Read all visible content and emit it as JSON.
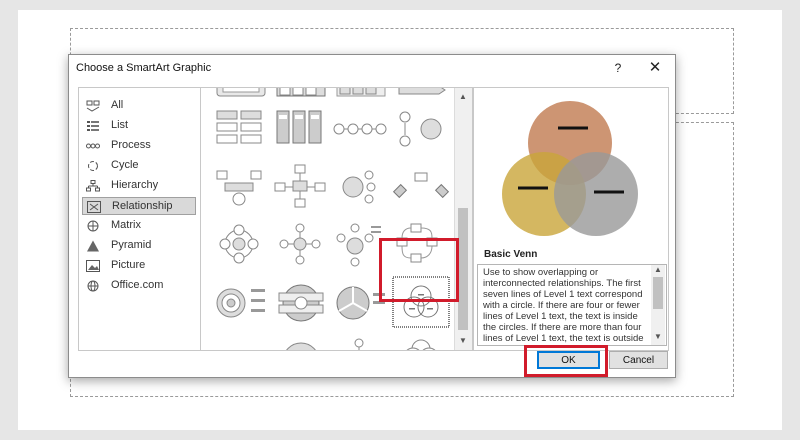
{
  "dialog": {
    "title": "Choose a SmartArt Graphic",
    "help_label": "?",
    "close_label": "✕"
  },
  "categories": [
    {
      "label": "All",
      "icon": "all-icon"
    },
    {
      "label": "List",
      "icon": "list-icon"
    },
    {
      "label": "Process",
      "icon": "process-icon"
    },
    {
      "label": "Cycle",
      "icon": "cycle-icon"
    },
    {
      "label": "Hierarchy",
      "icon": "hierarchy-icon"
    },
    {
      "label": "Relationship",
      "icon": "relationship-icon",
      "selected": true
    },
    {
      "label": "Matrix",
      "icon": "matrix-icon"
    },
    {
      "label": "Pyramid",
      "icon": "pyramid-icon"
    },
    {
      "label": "Picture",
      "icon": "picture-icon"
    },
    {
      "label": "Office.com",
      "icon": "office-icon"
    }
  ],
  "preview": {
    "name": "Basic Venn",
    "description": "Use to show overlapping or interconnected relationships. The first seven lines of Level 1 text correspond with a circle. If there are four or fewer lines of Level 1 text, the text is inside the circles. If there are more than four lines of Level 1 text, the text is outside",
    "marker": "—",
    "colors": {
      "top": "#c07a50",
      "left": "#c9a53a",
      "right": "#999999"
    }
  },
  "buttons": {
    "ok": "OK",
    "cancel": "Cancel"
  },
  "colors": {
    "highlight": "#d11b2b",
    "accent": "#0078d7"
  }
}
